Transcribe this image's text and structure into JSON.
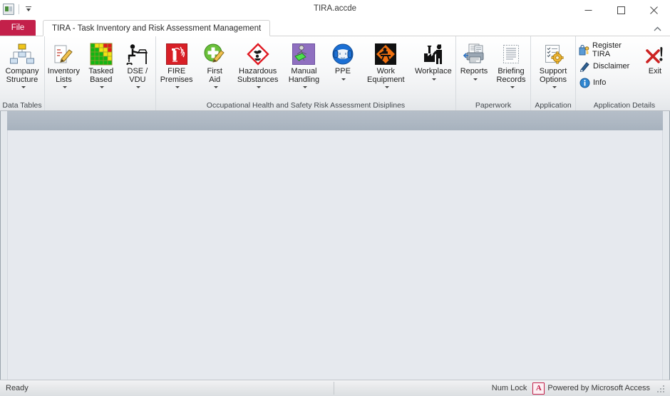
{
  "window": {
    "title": "TIRA.accde",
    "app_icon": "access-app-icon",
    "qat_dropdown": "customize-quick-access-toolbar",
    "minimize": "minimize-icon",
    "maximize": "maximize-icon",
    "close": "close-icon"
  },
  "tabs": {
    "file_label": "File",
    "main_label": "TIRA - Task Inventory and Risk Assessment Management",
    "collapse_icon": "ribbon-collapse-chevron-icon"
  },
  "ribbon": {
    "groups": [
      {
        "name": "data-tables",
        "label": "Data Tables",
        "buttons": [
          {
            "id": "company-structure",
            "label": "Company\nStructure",
            "icon": "org-chart-icon",
            "has_dropdown": true,
            "arrow_inline": true
          },
          {
            "id": "inventory-lists",
            "label": "Inventory\nLists",
            "icon": "clipboard-pencil-icon",
            "has_dropdown": true,
            "arrow_inline": true
          },
          {
            "id": "tasked-based",
            "label": "Tasked\nBased",
            "icon": "risk-matrix-icon",
            "has_dropdown": true,
            "arrow_inline": true
          },
          {
            "id": "dse-vdu",
            "label": "DSE /\nVDU",
            "icon": "desk-worker-icon",
            "has_dropdown": true,
            "arrow_inline": true
          }
        ]
      },
      {
        "name": "occupational-health-safety",
        "label": "Occupational Health and Safety Risk Assessment Disiplines",
        "buttons": [
          {
            "id": "fire-premises",
            "label": "FIRE\nPremises",
            "icon": "fire-extinguisher-icon",
            "has_dropdown": true,
            "arrow_inline": true
          },
          {
            "id": "first-aid",
            "label": "First\nAid",
            "icon": "first-aid-green-cross-icon",
            "has_dropdown": true,
            "arrow_inline": true
          },
          {
            "id": "hazardous-substances",
            "label": "Hazardous\nSubstances",
            "icon": "hazard-diamond-icon",
            "has_dropdown": true,
            "arrow_inline": true
          },
          {
            "id": "manual-handling",
            "label": "Manual\nHandling",
            "icon": "manual-handling-icon",
            "has_dropdown": true,
            "arrow_inline": true
          },
          {
            "id": "ppe",
            "label": "PPE",
            "icon": "ppe-ear-defenders-icon",
            "has_dropdown": true,
            "arrow_inline": false
          },
          {
            "id": "work-equipment",
            "label": "Work\nEquipment",
            "icon": "work-equipment-sign-icon",
            "has_dropdown": true,
            "arrow_inline": true
          },
          {
            "id": "workplace",
            "label": "Workplace",
            "icon": "factory-worker-icon",
            "has_dropdown": true,
            "arrow_inline": false
          }
        ]
      },
      {
        "name": "paperwork",
        "label": "Paperwork",
        "buttons": [
          {
            "id": "reports",
            "label": "Reports",
            "icon": "printer-report-icon",
            "has_dropdown": true,
            "arrow_inline": false
          },
          {
            "id": "briefing-records",
            "label": "Briefing\nRecords",
            "icon": "document-list-icon",
            "has_dropdown": true,
            "arrow_inline": true
          }
        ]
      },
      {
        "name": "application",
        "label": "Application",
        "buttons": [
          {
            "id": "support-options",
            "label": "Support\nOptions",
            "icon": "checklist-gear-icon",
            "has_dropdown": true,
            "arrow_inline": true
          }
        ]
      },
      {
        "name": "application-details",
        "label": "Application Details",
        "small_buttons": [
          {
            "id": "register-tira",
            "label": "Register TIRA",
            "icon": "key-lock-icon"
          },
          {
            "id": "disclaimer",
            "label": "Disclaimer",
            "icon": "pen-signature-icon"
          },
          {
            "id": "info",
            "label": "Info",
            "icon": "info-circle-icon"
          }
        ],
        "buttons": [
          {
            "id": "exit",
            "label": "Exit",
            "icon": "exit-red-cross-icon",
            "has_dropdown": false,
            "arrow_inline": false
          }
        ]
      }
    ]
  },
  "statusbar": {
    "message": "Ready",
    "num_lock": "Num Lock",
    "access_badge": "A",
    "powered_by": "Powered by Microsoft Access",
    "resize_grip": "resize-grip-icon"
  },
  "colors": {
    "file_tab": "#c3204a",
    "accent": "#c3204a",
    "content_band": "#aeb8c3",
    "content_surface": "#e6e9ee"
  }
}
